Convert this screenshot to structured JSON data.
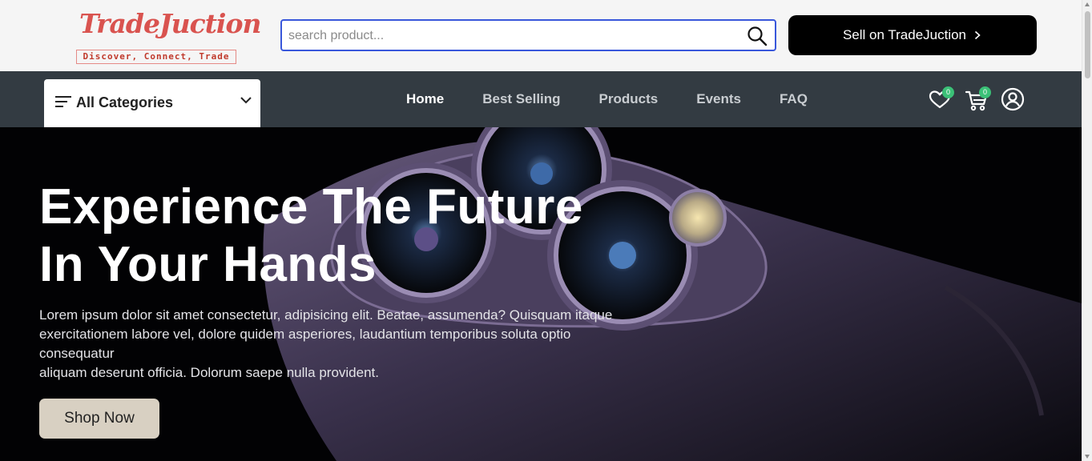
{
  "brand": {
    "name": "TradeJuction",
    "tagline": "Discover, Connect, Trade"
  },
  "search": {
    "placeholder": "search product...",
    "icon": "search-icon"
  },
  "header": {
    "sell_label": "Sell on TradeJuction",
    "sell_icon": "chevron-right-icon"
  },
  "categories": {
    "label": "All Categories",
    "icon": "menu-lines-icon",
    "toggle_icon": "chevron-down-icon"
  },
  "nav": {
    "links": [
      {
        "label": "Home",
        "active": true
      },
      {
        "label": "Best Selling",
        "active": false
      },
      {
        "label": "Products",
        "active": false
      },
      {
        "label": "Events",
        "active": false
      },
      {
        "label": "FAQ",
        "active": false
      }
    ]
  },
  "actions": {
    "wishlist_count": "0",
    "cart_count": "0",
    "wishlist_icon": "heart-icon",
    "cart_icon": "cart-icon",
    "profile_icon": "user-circle-icon"
  },
  "hero": {
    "title_line1": "Experience The Future",
    "title_line2": "In Your Hands",
    "text_line1": "Lorem ipsum dolor sit amet consectetur, adipisicing elit. Beatae, assumenda? Quisquam itaque",
    "text_line2": "exercitationem labore vel, dolore quidem asperiores, laudantium temporibus soluta optio",
    "text_line3": "consequatur",
    "text_line4": "aliquam deserunt officia. Dolorum saepe nulla provident.",
    "button_label": "Shop Now"
  },
  "colors": {
    "nav_bg": "#333b42",
    "accent_blue": "#3957db",
    "badge_green": "#3bc177",
    "brand_red": "#d9534f",
    "hero_button": "#d8d0c2"
  }
}
